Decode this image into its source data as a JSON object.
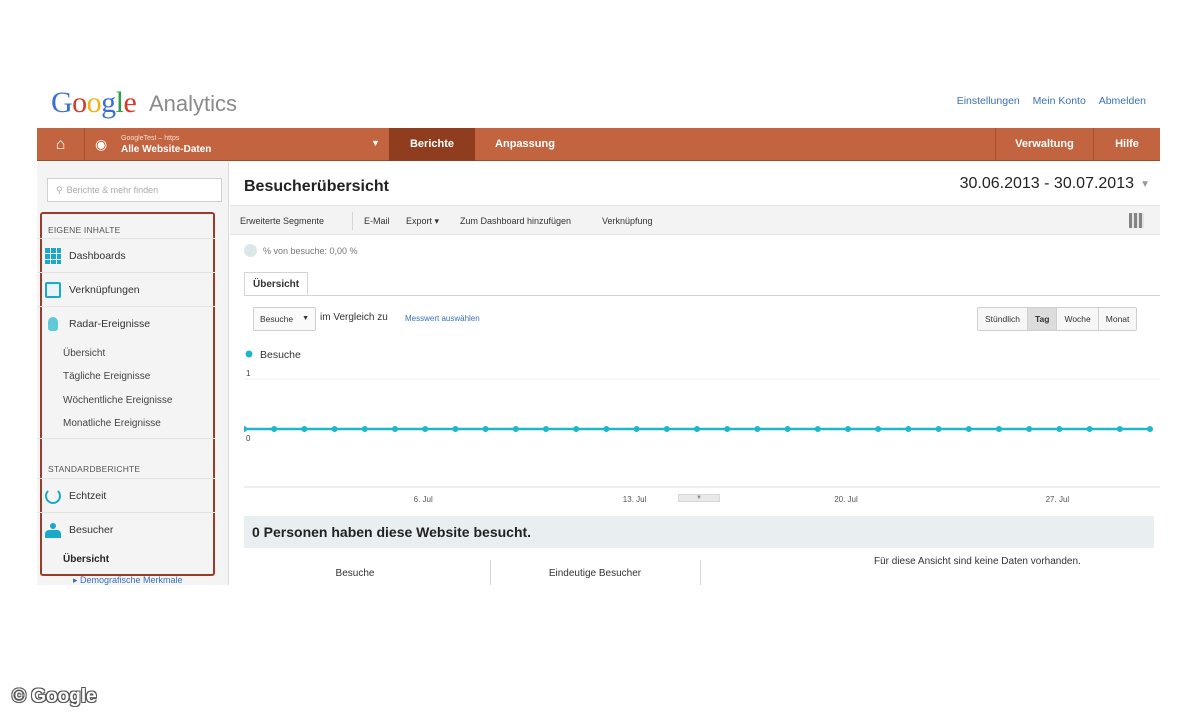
{
  "header": {
    "logo_google": [
      "G",
      "o",
      "o",
      "g",
      "l",
      "e"
    ],
    "logo_product": "Analytics",
    "links": [
      "Einstellungen",
      "Mein Konto",
      "Abmelden"
    ]
  },
  "nav": {
    "account_sub": "GoogleTest – https",
    "account_main": "Alle Website-Daten",
    "tabs": {
      "berichte": "Berichte",
      "anpassung": "Anpassung",
      "verwaltung": "Verwaltung",
      "hilfe": "Hilfe"
    },
    "brand_color": "#c2643f",
    "active_color": "#8f3d1e"
  },
  "sidebar": {
    "search_placeholder": "Berichte & mehr finden",
    "section_own": "EIGENE INHALTE",
    "dashboards": "Dashboards",
    "links": "Verknüpfungen",
    "radar": "Radar-Ereignisse",
    "radar_sub": [
      "Übersicht",
      "Tägliche Ereignisse",
      "Wöchentliche Ereignisse",
      "Monatliche Ereignisse"
    ],
    "section_std": "STANDARDBERICHTE",
    "realtime": "Echtzeit",
    "visitors": "Besucher",
    "visitors_sub": "Übersicht",
    "cut_item": "▸ Demografische Merkmale",
    "highlight_color": "#9b3b2a"
  },
  "main": {
    "title": "Besucherübersicht",
    "date_range": "30.06.2013 - 30.07.2013",
    "toolbar": [
      "Erweiterte Segmente",
      "E-Mail",
      "Export ▾",
      "Zum Dashboard hinzufügen",
      "Verknüpfung"
    ],
    "segment_text": "% von besuche: 0,00 %",
    "tab_overview": "Übersicht",
    "metric": "Besuche",
    "compare_text": "im Vergleich zu",
    "compare_link": "Messwert auswählen",
    "granularity": [
      "Stündlich",
      "Tag",
      "Woche",
      "Monat"
    ],
    "granularity_active": "Tag",
    "summary": "0 Personen haben diese Website besucht.",
    "col_visits": "Besuche",
    "col_unique": "Eindeutige Besucher",
    "no_data": "Für diese Ansicht sind keine Daten vorhanden."
  },
  "chart_data": {
    "type": "line",
    "series": [
      {
        "name": "Besuche",
        "color": "#1fb7c7",
        "values": [
          0,
          0,
          0,
          0,
          0,
          0,
          0,
          0,
          0,
          0,
          0,
          0,
          0,
          0,
          0,
          0,
          0,
          0,
          0,
          0,
          0,
          0,
          0,
          0,
          0,
          0,
          0,
          0,
          0,
          0,
          0
        ]
      }
    ],
    "x": [
      "30.06.",
      "01.07.",
      "02.07.",
      "03.07.",
      "04.07.",
      "05.07.",
      "06.07.",
      "07.07.",
      "08.07.",
      "09.07.",
      "10.07.",
      "11.07.",
      "12.07.",
      "13.07.",
      "14.07.",
      "15.07.",
      "16.07.",
      "17.07.",
      "18.07.",
      "19.07.",
      "20.07.",
      "21.07.",
      "22.07.",
      "23.07.",
      "24.07.",
      "25.07.",
      "26.07.",
      "27.07.",
      "28.07.",
      "29.07.",
      "30.07."
    ],
    "x_tick_labels": [
      {
        "index": 6,
        "label": "6. Jul"
      },
      {
        "index": 13,
        "label": "13. Jul"
      },
      {
        "index": 20,
        "label": "20. Jul"
      },
      {
        "index": 27,
        "label": "27. Jul"
      }
    ],
    "y_tick_labels": [
      "1",
      "0"
    ],
    "ylim": [
      0,
      1
    ],
    "legend": "top-left",
    "grid": true
  },
  "watermark": "© Google"
}
